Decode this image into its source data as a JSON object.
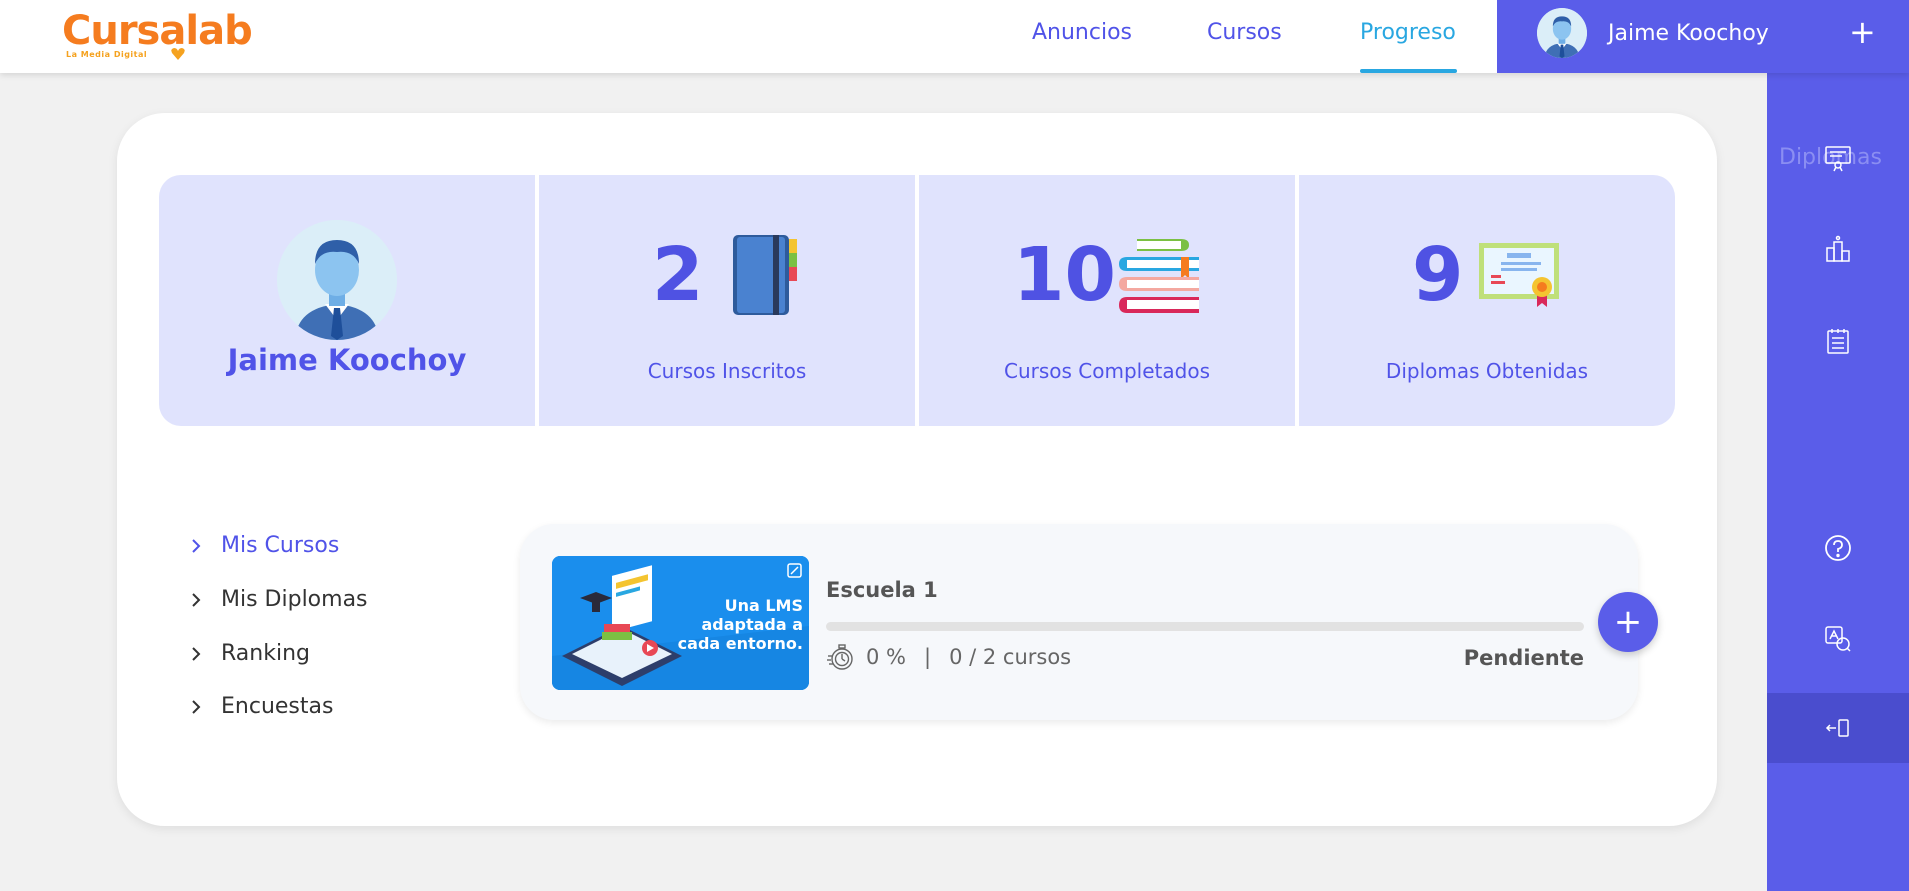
{
  "header": {
    "logo_text": "Cursalab",
    "logo_subtext": "La Media Digital",
    "nav": [
      {
        "label": "Anuncios",
        "active": false
      },
      {
        "label": "Cursos",
        "active": false
      },
      {
        "label": "Progreso",
        "active": true
      }
    ],
    "user_name": "Jaime Koochoy",
    "plus_label": "+"
  },
  "sidebar": {
    "diplomas_label": "Diplomas",
    "items": [
      {
        "icon": "diploma-icon"
      },
      {
        "icon": "ranking-icon"
      },
      {
        "icon": "survey-icon"
      },
      {
        "icon": "help-icon"
      },
      {
        "icon": "translate-icon"
      },
      {
        "icon": "logout-icon"
      }
    ]
  },
  "profile": {
    "name": "Jaime Koochoy"
  },
  "stats": [
    {
      "value": "2",
      "label": "Cursos Inscritos",
      "icon": "book-icon"
    },
    {
      "value": "10",
      "label": "Cursos Completados",
      "icon": "books-stack-icon"
    },
    {
      "value": "9",
      "label": "Diplomas Obtenidas",
      "icon": "certificate-icon"
    }
  ],
  "menu": [
    {
      "label": "Mis Cursos",
      "active": true
    },
    {
      "label": "Mis Diplomas",
      "active": false
    },
    {
      "label": "Ranking",
      "active": false
    },
    {
      "label": "Encuestas",
      "active": false
    }
  ],
  "course": {
    "title": "Escuela 1",
    "image_text_1": "Una LMS",
    "image_text_2": "adaptada a",
    "image_text_3": "cada entorno.",
    "progress_text": "0 %",
    "progress_value": 0,
    "separator": "|",
    "courses_text": "0 / 2 cursos",
    "status": "Pendiente",
    "plus_label": "+"
  },
  "colors": {
    "primary": "#5a5de9",
    "accent": "#29a7e1",
    "stat_bg": "#e0e3fd",
    "logo": "#f57c1f"
  }
}
